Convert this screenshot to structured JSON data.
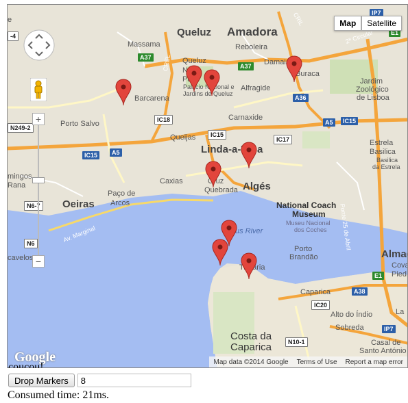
{
  "map": {
    "type_buttons": [
      "Map",
      "Satellite"
    ],
    "active_type": "Map",
    "labels": {
      "queluz_big": "Queluz",
      "amadora": "Amadora",
      "reboleira": "Reboleira",
      "massama": "Massama",
      "damaia": "Damaia",
      "buraca": "Buraca",
      "queluz_small": "Queluz",
      "palacio": "Palácio Nacional e",
      "palacio2": "Jardins de Queluz",
      "np1": "N",
      "np2": "Pa",
      "barcarena": "Barcarena",
      "alfragide": "Alfragide",
      "jardim1": "Jardim",
      "jardim2": "Zoológico",
      "jardim3": "de Lisboa",
      "porto_salvo": "Porto Salvo",
      "carnaxide": "Carnaxide",
      "queijas": "Queijas",
      "linda": "Linda-a-V",
      "linda_tail": "a",
      "estrela1": "Estrela",
      "estrela2": "Basilica",
      "estrela3": "Basilica",
      "estrela4": "da Estrela",
      "caxias": "Caxias",
      "cruz1": "Cruz",
      "cruz2": "Quebrada",
      "alges": "Algés",
      "minigos1": "mingos",
      "minigos2": "Rana",
      "oeiras": "Oeiras",
      "paco1": "Paço de",
      "paco2": "Arcos",
      "national1": "National Coach",
      "national2": "Museum",
      "national3": "Museu Nacional",
      "national4": "dos Coches",
      "river": "us River",
      "marginal": "Av. Marginal",
      "cavelos": "cavelos",
      "ponte": "Ponte 25 de Abril",
      "porto_brandao1": "Porto",
      "porto_brandao2": "Brandão",
      "trafaria": "Trafaria",
      "almada": "Almada",
      "cova": "Cova",
      "pied": "Pied",
      "caparica": "Caparica",
      "alto": "Alto do Índio",
      "sobreda": "Sobreda",
      "costa1": "Costa da",
      "costa2": "Caparica",
      "casal1": "Casal de",
      "casal2": "Santo António",
      "la": "La",
      "circular": "2ª Circular",
      "crel": "CREL",
      "cril": "CRIL"
    },
    "shields": {
      "a37a": "A37",
      "a37b": "A37",
      "ic18": "IC18",
      "a36": "A36",
      "ic15a": "IC15",
      "ic15b": "IC15",
      "ic15c": "IC15",
      "a5a": "A5",
      "a5b": "A5",
      "ic17": "IC17",
      "n249": "N249-2",
      "n67": "N6-7",
      "n6": "N6",
      "a38": "A38",
      "ic20": "IC20",
      "n101": "N10-1",
      "ip7a": "IP7",
      "ip7b": "IP7",
      "e1a": "E1",
      "e1b": "E1",
      "four": "-4",
      "e": "e"
    },
    "marker_count": 10,
    "marker_color": "#e2453c",
    "logo": "Google",
    "attribution": [
      "Map data ©2014 Google",
      "Terms of Use",
      "Report a map error"
    ]
  },
  "clipped_text": "coucou!",
  "controls": {
    "drop_button": "Drop Markers",
    "count_value": "8"
  },
  "status": "Consumed time: 21ms."
}
